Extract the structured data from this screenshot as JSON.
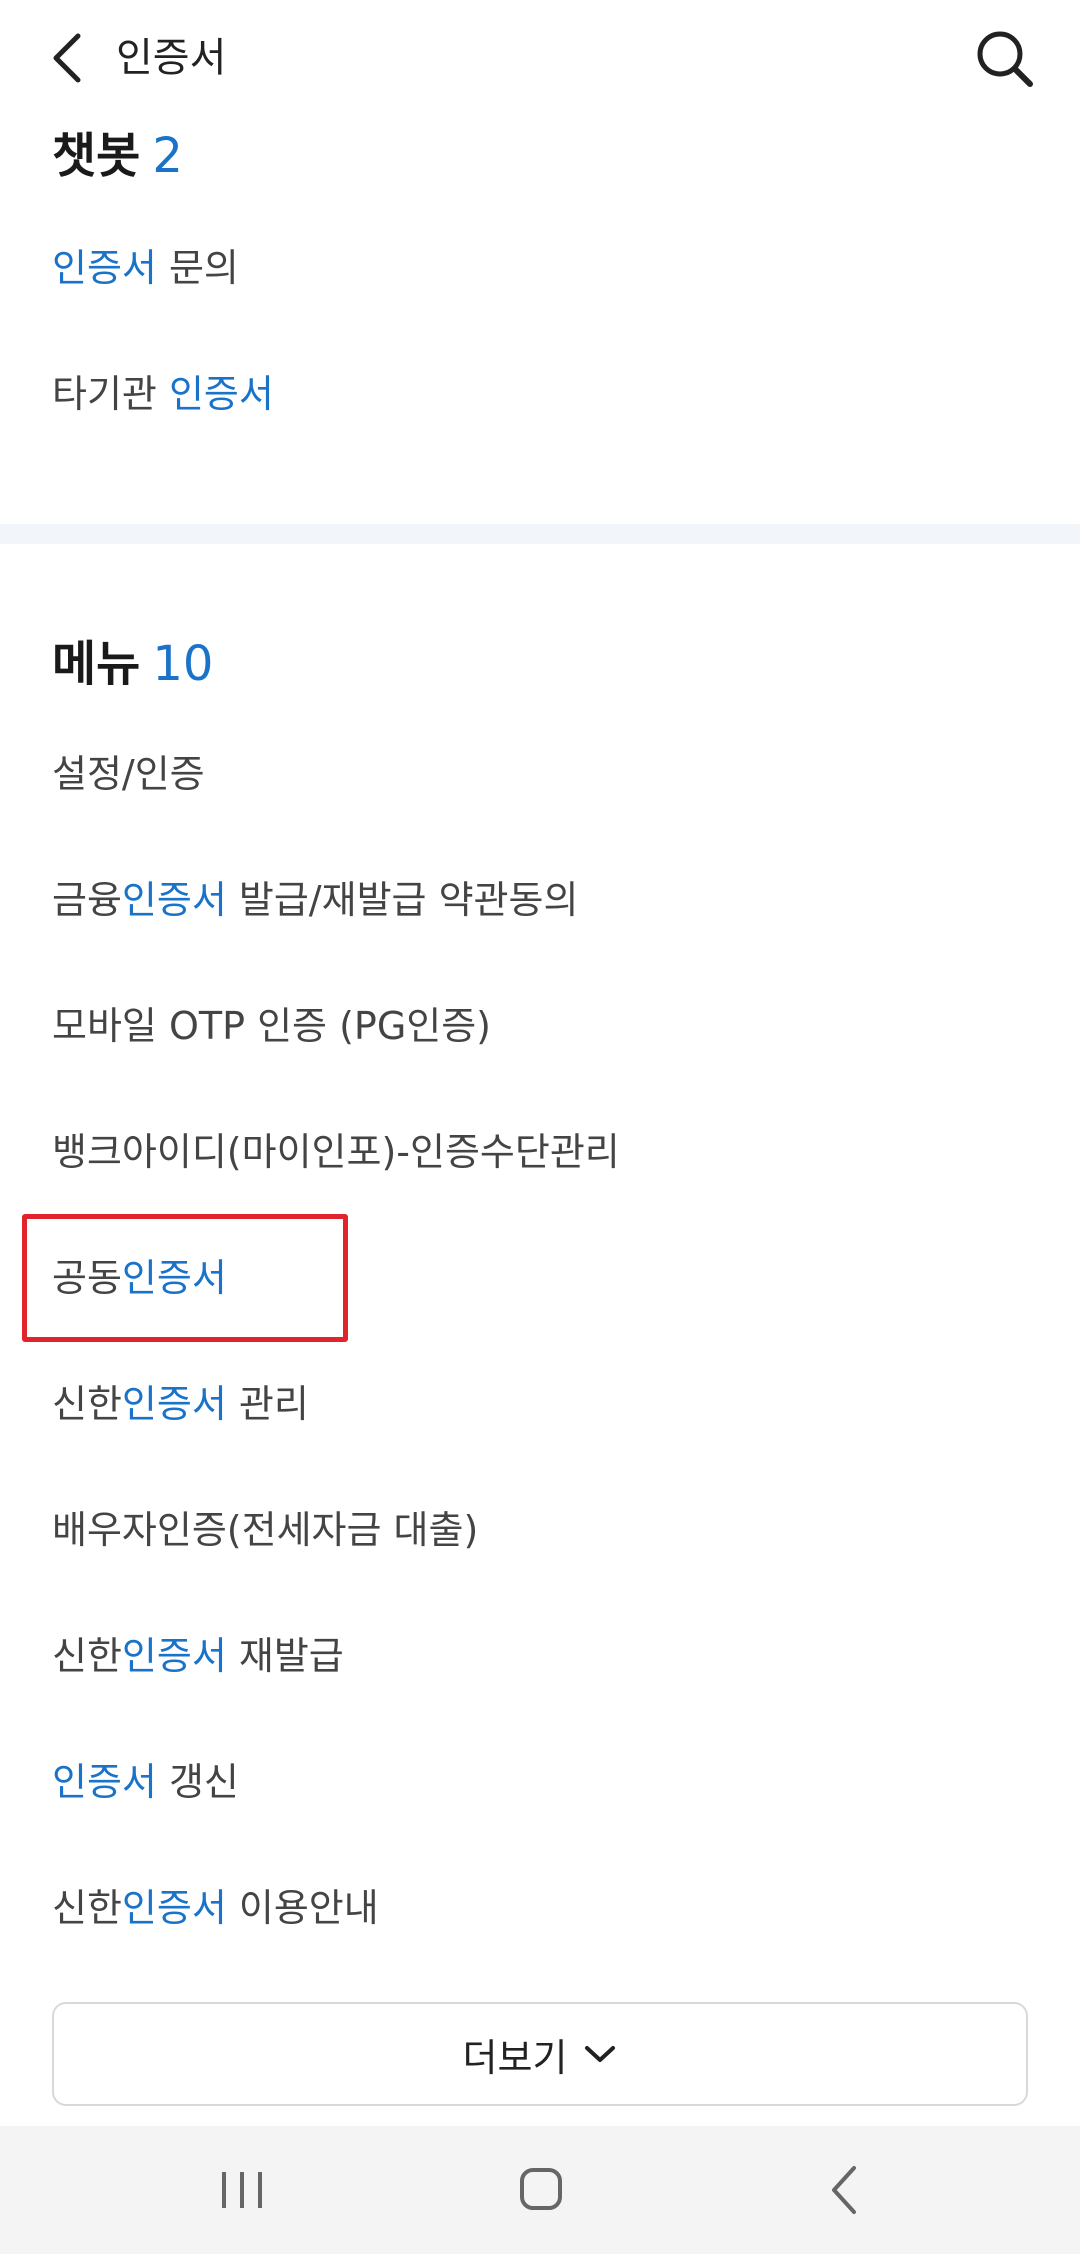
{
  "header": {
    "title": "인증서"
  },
  "chatbot": {
    "title": "챗봇",
    "count": "2",
    "items": [
      {
        "parts": [
          {
            "text": "인증서",
            "hl": true
          },
          {
            "text": " 문의",
            "hl": false
          }
        ]
      },
      {
        "parts": [
          {
            "text": "타기관 ",
            "hl": false
          },
          {
            "text": "인증서",
            "hl": true
          }
        ]
      }
    ]
  },
  "menu": {
    "title": "메뉴",
    "count": "10",
    "items": [
      {
        "parts": [
          {
            "text": "설정/인증",
            "hl": false
          }
        ]
      },
      {
        "parts": [
          {
            "text": "금융",
            "hl": false
          },
          {
            "text": "인증서",
            "hl": true
          },
          {
            "text": " 발급/재발급 약관동의",
            "hl": false
          }
        ]
      },
      {
        "parts": [
          {
            "text": "모바일 OTP 인증 (PG인증)",
            "hl": false
          }
        ]
      },
      {
        "parts": [
          {
            "text": "뱅크아이디(마이인포)-인증수단관리",
            "hl": false
          }
        ]
      },
      {
        "parts": [
          {
            "text": "공동",
            "hl": false
          },
          {
            "text": "인증서",
            "hl": true
          }
        ]
      },
      {
        "parts": [
          {
            "text": "신한",
            "hl": false
          },
          {
            "text": "인증서",
            "hl": true
          },
          {
            "text": " 관리",
            "hl": false
          }
        ]
      },
      {
        "parts": [
          {
            "text": "배우자인증(전세자금 대출)",
            "hl": false
          }
        ]
      },
      {
        "parts": [
          {
            "text": "신한",
            "hl": false
          },
          {
            "text": "인증서",
            "hl": true
          },
          {
            "text": " 재발급",
            "hl": false
          }
        ]
      },
      {
        "parts": [
          {
            "text": "인증서",
            "hl": true
          },
          {
            "text": " 갱신",
            "hl": false
          }
        ]
      },
      {
        "parts": [
          {
            "text": "신한",
            "hl": false
          },
          {
            "text": "인증서",
            "hl": true
          },
          {
            "text": " 이용안내",
            "hl": false
          }
        ]
      }
    ]
  },
  "more_button": {
    "label": "더보기"
  },
  "icons": {
    "back": "chevron-left-icon",
    "search": "search-icon",
    "more": "chevron-down-icon",
    "nav_recents": "recent-apps-icon",
    "nav_home": "home-icon",
    "nav_back": "back-icon"
  },
  "colors": {
    "accent": "#1a73c8",
    "highlight_box": "#e0242b",
    "divider": "#f2f5fa",
    "navbar": "#f4f4f4"
  }
}
